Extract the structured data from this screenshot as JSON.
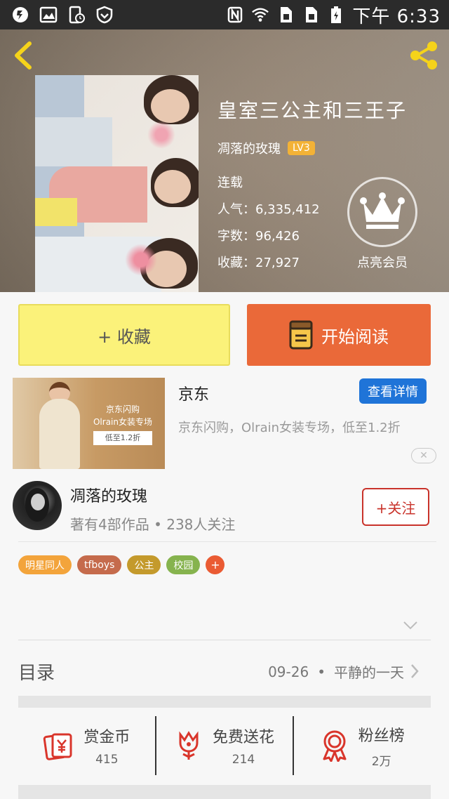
{
  "status_bar": {
    "time": "下午 6:33",
    "icons": [
      "app-icon",
      "image-icon",
      "phone-clock-icon",
      "shield-icon",
      "nfc-icon",
      "wifi-icon",
      "sim1-icon",
      "sim2-icon",
      "battery-icon"
    ]
  },
  "book": {
    "title": "皇室三公主和三王子",
    "author": "凋落的玫瑰",
    "level": "LV3",
    "status": "连载",
    "popularity": "人气：6,335,412",
    "word_count": "字数：96,426",
    "favorites": "收藏：27,927",
    "vip_label": "点亮会员"
  },
  "actions": {
    "favorite_label": "+ 收藏",
    "read_label": "开始阅读"
  },
  "ad": {
    "title": "京东",
    "button_label": "查看详情",
    "description": "京东闪购，Olrain女装专场，低至1.2折",
    "image_line1": "京东闪购",
    "image_line2": "Olrain女装专场",
    "image_line3": "低至1.2折",
    "close": "✕"
  },
  "author_card": {
    "name": "凋落的玫瑰",
    "stats": "著有4部作品 • 238人关注",
    "follow_label": "+关注"
  },
  "tags": [
    {
      "label": "明星同人",
      "color": "#f3a43b"
    },
    {
      "label": "tfboys",
      "color": "#c56b4c"
    },
    {
      "label": "公主",
      "color": "#c49a2c"
    },
    {
      "label": "校园",
      "color": "#86b34e"
    },
    {
      "label": "+",
      "color": "#ea5b33"
    }
  ],
  "toc": {
    "label": "目录",
    "latest_date": "09-26",
    "separator": "•",
    "latest_chapter": "平静的一天"
  },
  "stats": [
    {
      "label": "赏金币",
      "value": "415",
      "icon": "red-envelope-icon"
    },
    {
      "label": "免费送花",
      "value": "214",
      "icon": "flower-icon"
    },
    {
      "label": "粉丝榜",
      "value": "2万",
      "icon": "medal-icon"
    }
  ],
  "colors": {
    "favorite_bg": "#fbf27a",
    "read_bg": "#ea6939",
    "follow": "#c9332b",
    "ad_button": "#1f74d8",
    "icon_red": "#d9352b"
  }
}
